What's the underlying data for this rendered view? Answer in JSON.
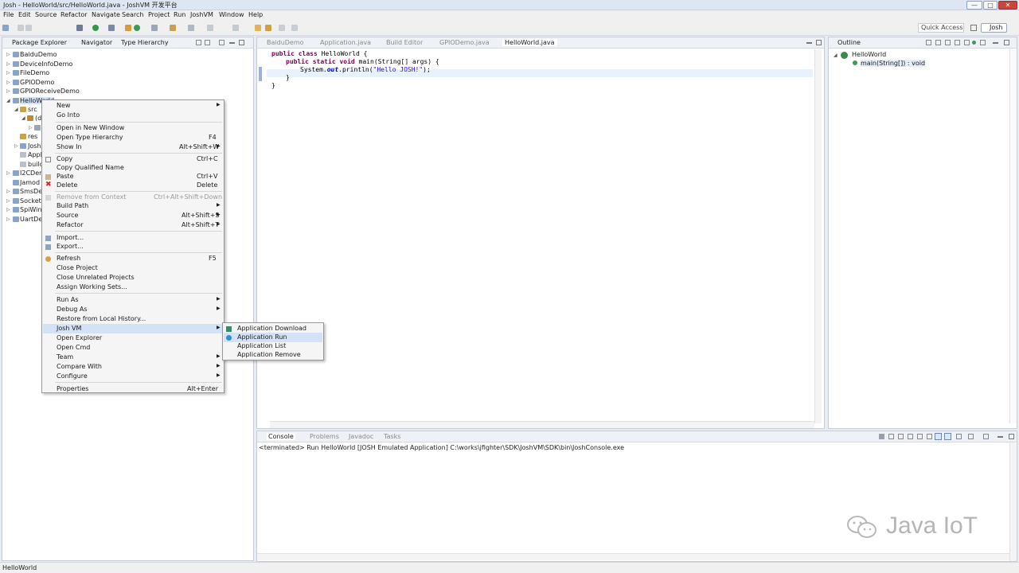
{
  "window": {
    "title": "Josh - HelloWorld/src/HelloWorld.java - JoshVM 开发平台",
    "minimize": "—",
    "maximize": "□",
    "close": "✕"
  },
  "menubar": [
    "File",
    "Edit",
    "Source",
    "Refactor",
    "Navigate",
    "Search",
    "Project",
    "Run",
    "JoshVM",
    "Window",
    "Help"
  ],
  "toolbar": {
    "quick_access": "Quick Access",
    "perspective": "Josh"
  },
  "package_explorer": {
    "tabs": [
      "Package Explorer",
      "Navigator",
      "Type Hierarchy"
    ],
    "items": [
      {
        "label": "BaiduDemo"
      },
      {
        "label": "DeviceInfoDemo"
      },
      {
        "label": "FileDemo"
      },
      {
        "label": "GPIODemo"
      },
      {
        "label": "GPIOReceiveDemo"
      },
      {
        "label": "HelloWorld"
      },
      {
        "label": "src"
      },
      {
        "label": "(d"
      },
      {
        "label": "res"
      },
      {
        "label": "JoshV"
      },
      {
        "label": "Appl"
      },
      {
        "label": "build"
      },
      {
        "label": "I2CDem"
      },
      {
        "label": "Jamod"
      },
      {
        "label": "SmsDer"
      },
      {
        "label": "SocketI"
      },
      {
        "label": "SpiWin"
      },
      {
        "label": "UartDer"
      }
    ]
  },
  "editor": {
    "tabs": [
      "BaiduDemo",
      "Application.java",
      "Build Editor",
      "GPIODemo.java",
      "HelloWorld.java"
    ],
    "active_tab": "HelloWorld.java",
    "code": {
      "line1_kw1": "public",
      "line1_kw2": "class",
      "line1_rest": " HelloWorld {",
      "line2_kw1": "public",
      "line2_kw2": "static",
      "line2_kw3": "void",
      "line2_rest": " main(String[] args) {",
      "line3_a": "System.",
      "line3_field": "out",
      "line3_b": ".println(",
      "line3_str": "\"Hello JOSH!\"",
      "line3_c": ");",
      "line4": "}",
      "line5": "}"
    }
  },
  "outline": {
    "tab": "Outline",
    "root": "HelloWorld",
    "child": "main(String[]) : void"
  },
  "context_menu": {
    "items": [
      {
        "label": "New",
        "accel": "",
        "submenu": true
      },
      {
        "label": "Go Into",
        "accel": ""
      },
      {
        "label": "Open in New Window",
        "accel": ""
      },
      {
        "label": "Open Type Hierarchy",
        "accel": "F4"
      },
      {
        "label": "Show In",
        "accel": "Alt+Shift+W",
        "submenu": true
      },
      {
        "label": "Copy",
        "accel": "Ctrl+C"
      },
      {
        "label": "Copy Qualified Name",
        "accel": ""
      },
      {
        "label": "Paste",
        "accel": "Ctrl+V"
      },
      {
        "label": "Delete",
        "accel": "Delete"
      },
      {
        "label": "Remove from Context",
        "accel": "Ctrl+Alt+Shift+Down",
        "disabled": true
      },
      {
        "label": "Build Path",
        "accel": "",
        "submenu": true
      },
      {
        "label": "Source",
        "accel": "Alt+Shift+S",
        "submenu": true
      },
      {
        "label": "Refactor",
        "accel": "Alt+Shift+T",
        "submenu": true
      },
      {
        "label": "Import...",
        "accel": ""
      },
      {
        "label": "Export...",
        "accel": ""
      },
      {
        "label": "Refresh",
        "accel": "F5"
      },
      {
        "label": "Close Project",
        "accel": ""
      },
      {
        "label": "Close Unrelated Projects",
        "accel": ""
      },
      {
        "label": "Assign Working Sets...",
        "accel": ""
      },
      {
        "label": "Run As",
        "accel": "",
        "submenu": true
      },
      {
        "label": "Debug As",
        "accel": "",
        "submenu": true
      },
      {
        "label": "Restore from Local History...",
        "accel": ""
      },
      {
        "label": "Josh VM",
        "accel": "",
        "submenu": true,
        "highlighted": true
      },
      {
        "label": "Open Explorer",
        "accel": ""
      },
      {
        "label": "Open Cmd",
        "accel": ""
      },
      {
        "label": "Team",
        "accel": "",
        "submenu": true
      },
      {
        "label": "Compare With",
        "accel": "",
        "submenu": true
      },
      {
        "label": "Configure",
        "accel": "",
        "submenu": true
      },
      {
        "label": "Properties",
        "accel": "Alt+Enter"
      }
    ]
  },
  "submenu": {
    "items": [
      "Application Download",
      "Application Run",
      "Application List",
      "Application Remove"
    ]
  },
  "console": {
    "tabs": [
      "Console",
      "Problems",
      "Javadoc",
      "Tasks"
    ],
    "text": "<terminated> Run HelloWorld [JOSH Emulated Application] C:\\works\\jfighter\\SDK\\JoshVM\\SDK\\bin\\JoshConsole.exe"
  },
  "watermark": "Java IoT",
  "status": {
    "text": "HelloWorld"
  },
  "colors": {
    "accent": "#d4e2f6",
    "keyword": "#7f0055",
    "string": "#2a00ff"
  }
}
